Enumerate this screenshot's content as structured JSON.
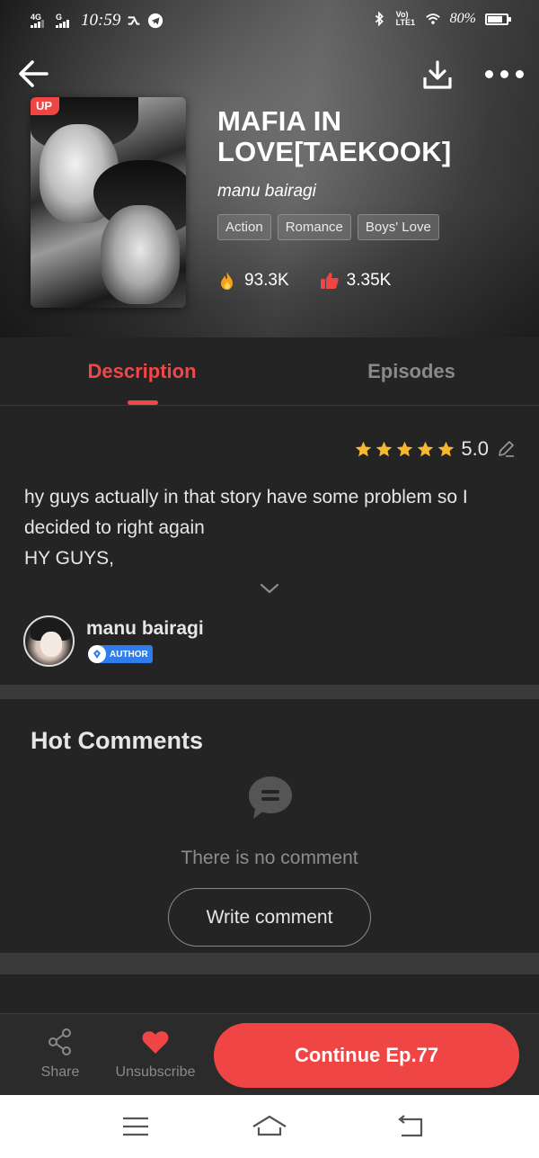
{
  "status_bar": {
    "network_left": "4G",
    "network_right": "G",
    "time": "10:59",
    "lte_label": "Vo) LTE1",
    "battery_percent": "80%",
    "battery_level": 0.8
  },
  "topbar": {
    "back_icon": "arrow-left-icon",
    "download_icon": "download-icon",
    "more_icon": "more-dots-icon"
  },
  "book": {
    "badge": "UP",
    "title": "MAFIA IN LOVE[TAEKOOK]",
    "author": "manu bairagi",
    "tags": [
      "Action",
      "Romance",
      "Boys' Love"
    ],
    "views": "93.3K",
    "likes": "3.35K"
  },
  "tabs": {
    "description": "Description",
    "episodes": "Episodes",
    "active": "Description"
  },
  "rating": {
    "stars": 5,
    "score": "5.0"
  },
  "description": {
    "line1": "hy guys actually in that story have some problem so I decided to right again",
    "line2": "HY GUYS,"
  },
  "author_card": {
    "name": "manu bairagi",
    "badge": "AUTHOR"
  },
  "comments": {
    "heading": "Hot Comments",
    "empty_text": "There is no comment",
    "write_label": "Write comment"
  },
  "actions": {
    "share": "Share",
    "unsubscribe": "Unsubscribe",
    "continue": "Continue Ep.77"
  },
  "colors": {
    "accent": "#f04545",
    "background": "#242424",
    "muted": "#8a8a8a",
    "author_badge": "#2f7de8",
    "star": "#f5b82e"
  }
}
